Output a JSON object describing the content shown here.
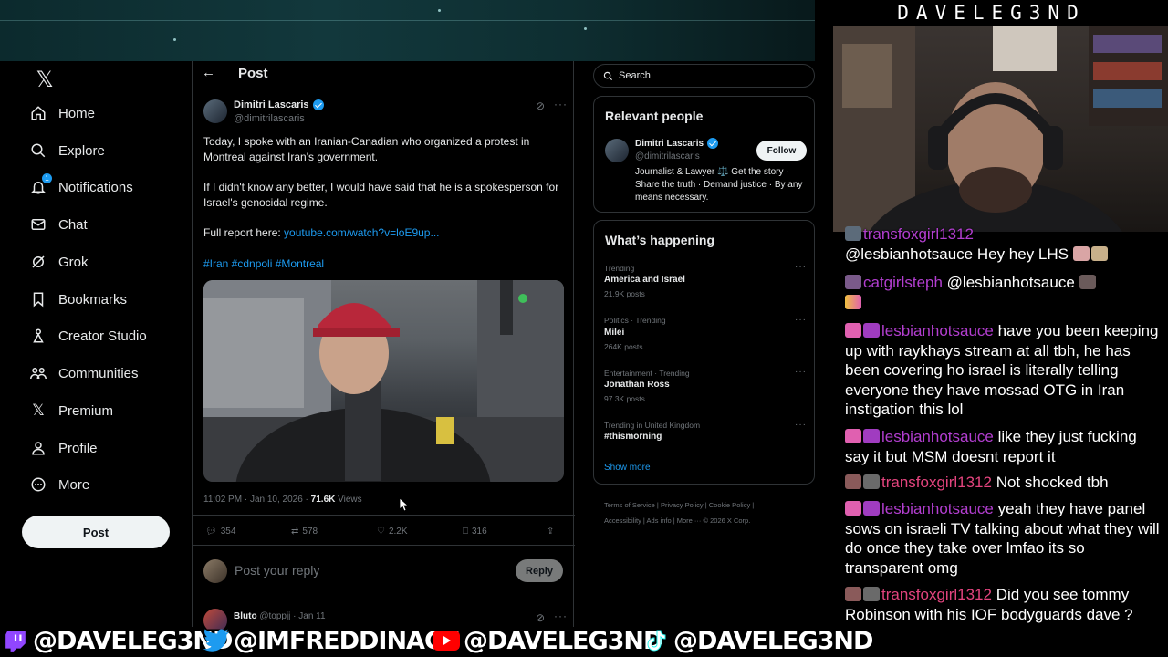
{
  "overlay": {
    "streamer_title": "DAVELEG3ND",
    "socials": [
      {
        "platform_icon": "twitch-icon",
        "handle": "@DAVELEG3ND"
      },
      {
        "platform_icon": "twitter-bird-icon",
        "handle": "@IMFREDDINAGE"
      },
      {
        "platform_icon": "youtube-icon",
        "handle": "@DAVELEG3ND"
      },
      {
        "platform_icon": "tiktok-icon",
        "handle": "@DAVELEG3ND"
      }
    ],
    "colors": {
      "twitch": "#9146ff",
      "youtube": "#ff0000",
      "chat_user_pink": "#b23ecf",
      "chat_user_red": "#e3447e"
    }
  },
  "x_app": {
    "nav": [
      {
        "icon": "x-logo-icon",
        "label": ""
      },
      {
        "icon": "home-icon",
        "label": "Home"
      },
      {
        "icon": "search-icon",
        "label": "Explore"
      },
      {
        "icon": "bell-icon",
        "label": "Notifications",
        "badge": "1"
      },
      {
        "icon": "mail-icon",
        "label": "Chat"
      },
      {
        "icon": "grok-icon",
        "label": "Grok"
      },
      {
        "icon": "bookmark-icon",
        "label": "Bookmarks"
      },
      {
        "icon": "creator-studio-icon",
        "label": "Creator Studio"
      },
      {
        "icon": "communities-icon",
        "label": "Communities"
      },
      {
        "icon": "x-logo-icon",
        "label": "Premium"
      },
      {
        "icon": "person-icon",
        "label": "Profile"
      },
      {
        "icon": "more-circle-icon",
        "label": "More"
      }
    ],
    "post_button": "Post",
    "header_title": "Post",
    "post": {
      "author_name": "Dimitri Lascaris",
      "author_handle": "@dimitrilascaris",
      "para1": "Today, I spoke with an Iranian-Canadian who organized a protest in Montreal against Iran's government.",
      "para2": "If I didn't know any better, I would have said that he is a spokesperson for Israel's genocidal regime.",
      "report_prefix": "Full report here: ",
      "report_link": "youtube.com/watch?v=loE9up...",
      "hashtags": "#Iran #cdnpoli #Montreal",
      "timestamp": "11:02 PM · Jan 10, 2026 · ",
      "views_count": "71.6K",
      "views_label": " Views",
      "replies": "354",
      "reposts": "578",
      "likes": "2.2K",
      "bookmarks": "316"
    },
    "reply_placeholder": "Post your reply",
    "reply_button": "Reply",
    "next_reply": {
      "name": "Bluto",
      "meta": " @toppjj · Jan 11"
    },
    "search_placeholder": "Search",
    "relevant": {
      "title": "Relevant people",
      "name": "Dimitri Lascaris",
      "handle": "@dimitrilascaris",
      "bio": "Journalist & Lawyer ⚖️ Get the story · Share the truth · Demand justice · By any means necessary.",
      "follow": "Follow"
    },
    "happening": {
      "title": "What’s happening",
      "trends": [
        {
          "meta": "Trending",
          "topic": "America and Israel",
          "count": "21.9K posts"
        },
        {
          "meta": "Politics · Trending",
          "topic": "Milei",
          "count": "264K posts"
        },
        {
          "meta": "Entertainment · Trending",
          "topic": "Jonathan Ross",
          "count": "97.3K posts"
        },
        {
          "meta": "Trending in United Kingdom",
          "topic": "#thismorning",
          "count": ""
        }
      ],
      "show_more": "Show more"
    },
    "footer": {
      "line1": "Terms of Service  |  Privacy Policy  |  Cookie Policy  |",
      "line2": "Accessibility  |  Ads info  |  More ···  © 2026 X Corp."
    }
  },
  "chat": [
    {
      "user": "transfoxgirl1312",
      "text": "",
      "partial": true
    },
    {
      "user": "",
      "text": "@lesbianhotsauce Hey hey LHS"
    },
    {
      "user": "catgirlsteph",
      "text": " @lesbianhotsauce"
    },
    {
      "user": "lesbianhotsauce",
      "text": " have you been keeping up with raykhays stream at all tbh, he has been covering ho israel is literally telling everyone they have mossad OTG in Iran instigation this lol"
    },
    {
      "user": "lesbianhotsauce",
      "text": " like they just fucking say it but MSM doesnt report it"
    },
    {
      "user": "transfoxgirl1312",
      "text": " Not shocked tbh"
    },
    {
      "user": "lesbianhotsauce",
      "text": " yeah they have panel sows on israeli TV talking about what they will do once they take over lmfao its so transparent omg"
    },
    {
      "user": "transfoxgirl1312",
      "text": " Did you see tommy Robinson with his IOF bodyguards dave ?"
    }
  ]
}
